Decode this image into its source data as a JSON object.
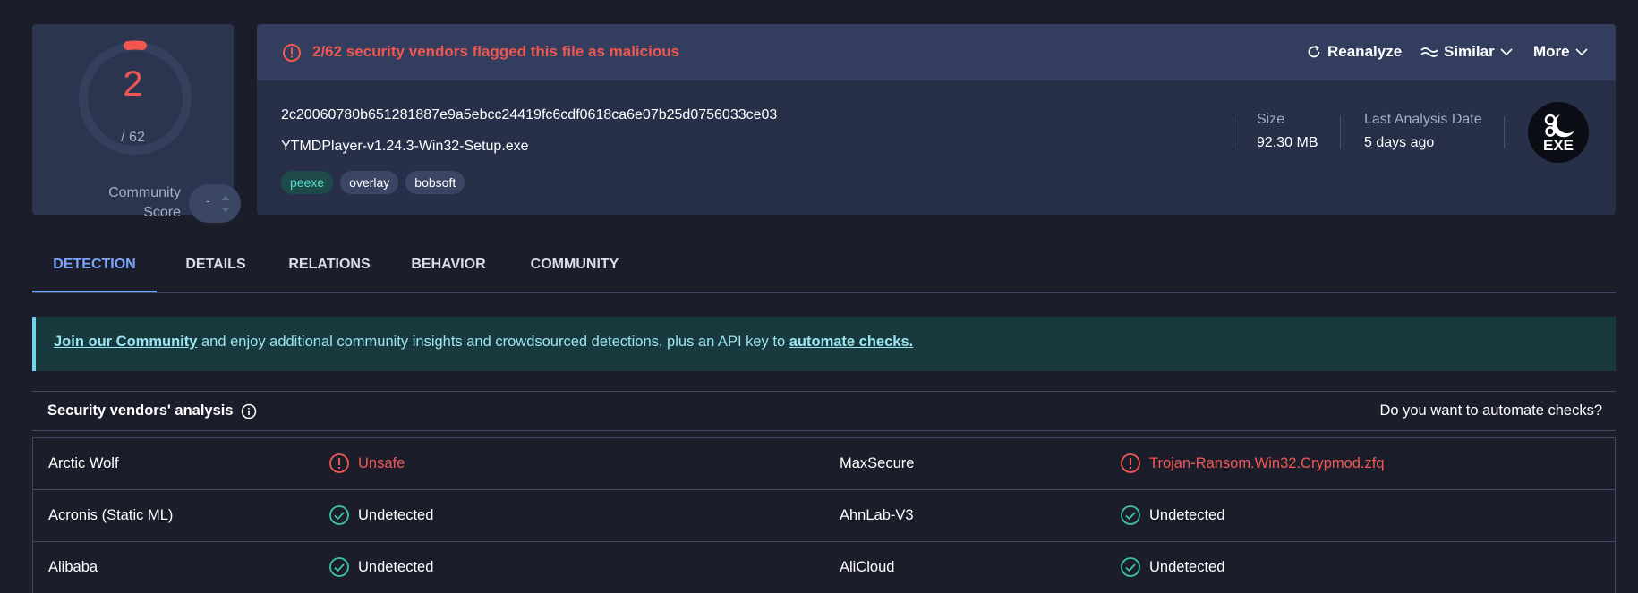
{
  "score": {
    "detections": "2",
    "total": "/ 62",
    "community_label_line1": "Community",
    "community_label_line2": "Score",
    "community_value": "-",
    "colors": {
      "malicious": "#f25650",
      "track": "#34405c"
    }
  },
  "alert": {
    "icon": "warning-circle-icon",
    "text": "2/62 security vendors flagged this file as malicious"
  },
  "actions": {
    "reanalyze": "Reanalyze",
    "similar": "Similar",
    "more": "More"
  },
  "file": {
    "hash": "2c20060780b651281887e9a5ebcc24419fc6cdf0618ca6e07b25d0756033ce03",
    "name": "YTMDPlayer-v1.24.3-Win32-Setup.exe",
    "tags": [
      "peexe",
      "overlay",
      "bobsoft"
    ],
    "size_label": "Size",
    "size_value": "92.30 MB",
    "date_label": "Last Analysis Date",
    "date_value": "5 days ago",
    "type_badge": "EXE"
  },
  "tabs": [
    "DETECTION",
    "DETAILS",
    "RELATIONS",
    "BEHAVIOR",
    "COMMUNITY"
  ],
  "banner": {
    "link1": "Join our Community",
    "middle": " and enjoy additional community insights and crowdsourced detections, plus an API key to ",
    "link2": "automate checks."
  },
  "vendors": {
    "title": "Security vendors' analysis",
    "automate": "Do you want to automate checks?",
    "rows": [
      {
        "left_vendor": "Arctic Wolf",
        "left_result": "Unsafe",
        "left_status": "malicious",
        "right_vendor": "MaxSecure",
        "right_result": "Trojan-Ransom.Win32.Crypmod.zfq",
        "right_status": "malicious"
      },
      {
        "left_vendor": "Acronis (Static ML)",
        "left_result": "Undetected",
        "left_status": "clean",
        "right_vendor": "AhnLab-V3",
        "right_result": "Undetected",
        "right_status": "clean"
      },
      {
        "left_vendor": "Alibaba",
        "left_result": "Undetected",
        "left_status": "clean",
        "right_vendor": "AliCloud",
        "right_result": "Undetected",
        "right_status": "clean"
      }
    ]
  }
}
